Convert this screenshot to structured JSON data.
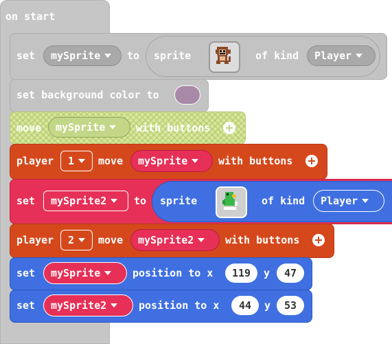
{
  "hat": {
    "label": "on start"
  },
  "row1": {
    "set": "set",
    "variable": "mySprite",
    "to": "to",
    "sprite": "sprite",
    "of_kind": "of kind",
    "kind": "Player",
    "sprite_image": "monkey-sprite"
  },
  "row2": {
    "label": "set background color to",
    "color": "#a88aa8"
  },
  "row3": {
    "move": "move",
    "variable": "mySprite",
    "with_buttons": "with buttons"
  },
  "row4": {
    "player": "player",
    "number": "1",
    "move": "move",
    "variable": "mySprite",
    "with_buttons": "with buttons"
  },
  "row5": {
    "set": "set",
    "variable": "mySprite2",
    "to": "to",
    "sprite": "sprite",
    "of_kind": "of kind",
    "kind": "Player",
    "sprite_image": "duck-sprite"
  },
  "row6": {
    "player": "player",
    "number": "2",
    "move": "move",
    "variable": "mySprite2",
    "with_buttons": "with buttons"
  },
  "row7": {
    "set": "set",
    "variable": "mySprite",
    "position_to_x": "position to x",
    "x": "119",
    "y_label": "y",
    "y": "47"
  },
  "row8": {
    "set": "set",
    "variable": "mySprite2",
    "position_to_x": "position to x",
    "x": "44",
    "y_label": "y",
    "y": "53"
  }
}
